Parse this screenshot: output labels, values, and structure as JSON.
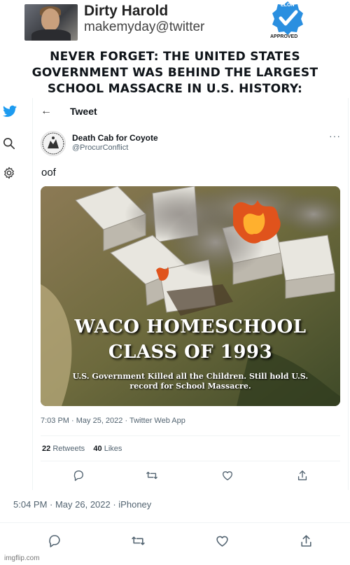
{
  "outer_tweet": {
    "display_name": "Dirty Harold",
    "handle": "makemyday@twitter",
    "badge_top_text": "ELON",
    "badge_bottom_text": "APPROVED",
    "headline": "NEVER FORGET: THE UNITED STATES GOVERNMENT WAS BEHIND THE LARGEST SCHOOL MASSACRE IN U.S. HISTORY:",
    "timestamp": "5:04 PM · May 26, 2022 · iPhoney"
  },
  "inner_tweet": {
    "back_icon": "arrow-left-icon",
    "title": "Tweet",
    "author_name": "Death Cab for Coyote",
    "author_handle": "@ProcurConflict",
    "more_label": "···",
    "text": "oof",
    "photo": {
      "title_line1": "WACO HOMESCHOOL",
      "title_line2": "CLASS OF 1993",
      "caption_line1": "U.S. Government Killed all the Children. Still hold U.S.",
      "caption_line2": "record for School Massacre."
    },
    "timestamp": "7:03 PM · May 25, 2022 · Twitter Web App",
    "retweets_count": "22",
    "retweets_label": "Retweets",
    "likes_count": "40",
    "likes_label": "Likes"
  },
  "left_rail": {
    "icons": [
      "twitter-bird-icon",
      "search-icon",
      "gear-icon"
    ]
  },
  "watermark": "imgflip.com",
  "colors": {
    "twitter_blue": "#1d9bf0",
    "badge_blue": "#2a8fe0",
    "muted_text": "#536471",
    "fire": "#e0531c"
  }
}
